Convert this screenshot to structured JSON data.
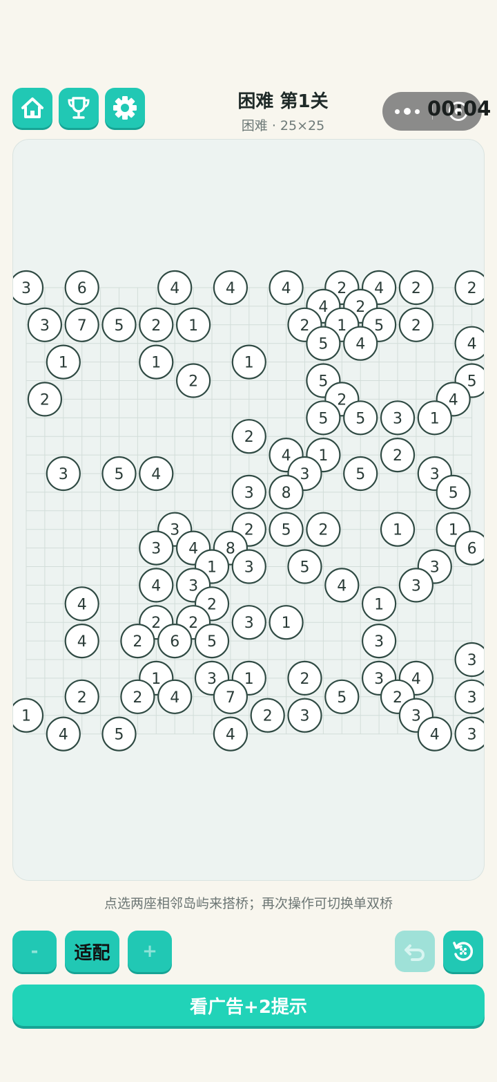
{
  "header": {
    "title": "困难 第1关",
    "subtitle": "困难 · 25×25",
    "timer": "00:04"
  },
  "icons": {
    "home": "home-icon",
    "trophy": "trophy-icon",
    "settings": "gear-icon",
    "undo": "undo-icon",
    "reset": "restart-icon"
  },
  "colors": {
    "accent": "#21c8b4",
    "island_stroke": "#2f4a43",
    "grid": "#d2ddd9"
  },
  "board": {
    "islands": [
      {
        "c": 0,
        "r": 0,
        "n": 3
      },
      {
        "c": 3,
        "r": 0,
        "n": 6
      },
      {
        "c": 8,
        "r": 0,
        "n": 4
      },
      {
        "c": 11,
        "r": 0,
        "n": 4
      },
      {
        "c": 14,
        "r": 0,
        "n": 4
      },
      {
        "c": 17,
        "r": 0,
        "n": 2
      },
      {
        "c": 19,
        "r": 0,
        "n": 4
      },
      {
        "c": 21,
        "r": 0,
        "n": 2
      },
      {
        "c": 24,
        "r": 0,
        "n": 2
      },
      {
        "c": 16,
        "r": 1,
        "n": 4
      },
      {
        "c": 18,
        "r": 1,
        "n": 2
      },
      {
        "c": 1,
        "r": 2,
        "n": 3
      },
      {
        "c": 3,
        "r": 2,
        "n": 7
      },
      {
        "c": 5,
        "r": 2,
        "n": 5
      },
      {
        "c": 7,
        "r": 2,
        "n": 2
      },
      {
        "c": 9,
        "r": 2,
        "n": 1
      },
      {
        "c": 15,
        "r": 2,
        "n": 2
      },
      {
        "c": 17,
        "r": 2,
        "n": 1
      },
      {
        "c": 19,
        "r": 2,
        "n": 5
      },
      {
        "c": 21,
        "r": 2,
        "n": 2
      },
      {
        "c": 16,
        "r": 3,
        "n": 5
      },
      {
        "c": 18,
        "r": 3,
        "n": 4
      },
      {
        "c": 24,
        "r": 3,
        "n": 4
      },
      {
        "c": 2,
        "r": 4,
        "n": 1
      },
      {
        "c": 7,
        "r": 4,
        "n": 1
      },
      {
        "c": 12,
        "r": 4,
        "n": 1
      },
      {
        "c": 9,
        "r": 5,
        "n": 2
      },
      {
        "c": 16,
        "r": 5,
        "n": 5
      },
      {
        "c": 24,
        "r": 5,
        "n": 5
      },
      {
        "c": 1,
        "r": 6,
        "n": 2
      },
      {
        "c": 17,
        "r": 6,
        "n": 2
      },
      {
        "c": 23,
        "r": 6,
        "n": 4
      },
      {
        "c": 16,
        "r": 7,
        "n": 5
      },
      {
        "c": 18,
        "r": 7,
        "n": 5
      },
      {
        "c": 20,
        "r": 7,
        "n": 3
      },
      {
        "c": 22,
        "r": 7,
        "n": 1
      },
      {
        "c": 12,
        "r": 8,
        "n": 2
      },
      {
        "c": 14,
        "r": 9,
        "n": 4
      },
      {
        "c": 16,
        "r": 9,
        "n": 1
      },
      {
        "c": 20,
        "r": 9,
        "n": 2
      },
      {
        "c": 2,
        "r": 10,
        "n": 3
      },
      {
        "c": 5,
        "r": 10,
        "n": 5
      },
      {
        "c": 7,
        "r": 10,
        "n": 4
      },
      {
        "c": 15,
        "r": 10,
        "n": 3
      },
      {
        "c": 18,
        "r": 10,
        "n": 5
      },
      {
        "c": 22,
        "r": 10,
        "n": 3
      },
      {
        "c": 12,
        "r": 11,
        "n": 3
      },
      {
        "c": 14,
        "r": 11,
        "n": 8
      },
      {
        "c": 23,
        "r": 11,
        "n": 5
      },
      {
        "c": 8,
        "r": 13,
        "n": 3
      },
      {
        "c": 12,
        "r": 13,
        "n": 2
      },
      {
        "c": 14,
        "r": 13,
        "n": 5
      },
      {
        "c": 16,
        "r": 13,
        "n": 2
      },
      {
        "c": 20,
        "r": 13,
        "n": 1
      },
      {
        "c": 23,
        "r": 13,
        "n": 1
      },
      {
        "c": 7,
        "r": 14,
        "n": 3
      },
      {
        "c": 9,
        "r": 14,
        "n": 4
      },
      {
        "c": 11,
        "r": 14,
        "n": 8
      },
      {
        "c": 24,
        "r": 14,
        "n": 6
      },
      {
        "c": 10,
        "r": 15,
        "n": 1
      },
      {
        "c": 12,
        "r": 15,
        "n": 3
      },
      {
        "c": 15,
        "r": 15,
        "n": 5
      },
      {
        "c": 22,
        "r": 15,
        "n": 3
      },
      {
        "c": 7,
        "r": 16,
        "n": 4
      },
      {
        "c": 9,
        "r": 16,
        "n": 3
      },
      {
        "c": 17,
        "r": 16,
        "n": 4
      },
      {
        "c": 21,
        "r": 16,
        "n": 3
      },
      {
        "c": 3,
        "r": 17,
        "n": 4
      },
      {
        "c": 10,
        "r": 17,
        "n": 2
      },
      {
        "c": 19,
        "r": 17,
        "n": 1
      },
      {
        "c": 7,
        "r": 18,
        "n": 2
      },
      {
        "c": 9,
        "r": 18,
        "n": 2
      },
      {
        "c": 12,
        "r": 18,
        "n": 3
      },
      {
        "c": 14,
        "r": 18,
        "n": 1
      },
      {
        "c": 3,
        "r": 19,
        "n": 4
      },
      {
        "c": 6,
        "r": 19,
        "n": 2
      },
      {
        "c": 8,
        "r": 19,
        "n": 6
      },
      {
        "c": 10,
        "r": 19,
        "n": 5
      },
      {
        "c": 19,
        "r": 19,
        "n": 3
      },
      {
        "c": 24,
        "r": 20,
        "n": 3
      },
      {
        "c": 7,
        "r": 21,
        "n": 1
      },
      {
        "c": 10,
        "r": 21,
        "n": 3
      },
      {
        "c": 12,
        "r": 21,
        "n": 1
      },
      {
        "c": 15,
        "r": 21,
        "n": 2
      },
      {
        "c": 19,
        "r": 21,
        "n": 3
      },
      {
        "c": 21,
        "r": 21,
        "n": 4
      },
      {
        "c": 3,
        "r": 22,
        "n": 2
      },
      {
        "c": 6,
        "r": 22,
        "n": 2
      },
      {
        "c": 8,
        "r": 22,
        "n": 4
      },
      {
        "c": 11,
        "r": 22,
        "n": 7
      },
      {
        "c": 17,
        "r": 22,
        "n": 5
      },
      {
        "c": 20,
        "r": 22,
        "n": 2
      },
      {
        "c": 24,
        "r": 22,
        "n": 3
      },
      {
        "c": 0,
        "r": 23,
        "n": 1
      },
      {
        "c": 13,
        "r": 23,
        "n": 2
      },
      {
        "c": 15,
        "r": 23,
        "n": 3
      },
      {
        "c": 21,
        "r": 23,
        "n": 3
      },
      {
        "c": 2,
        "r": 24,
        "n": 4
      },
      {
        "c": 5,
        "r": 24,
        "n": 5
      },
      {
        "c": 11,
        "r": 24,
        "n": 4
      },
      {
        "c": 22,
        "r": 24,
        "n": 4
      },
      {
        "c": 24,
        "r": 24,
        "n": 3
      }
    ]
  },
  "hint": "点选两座相邻岛屿来搭桥；再次操作可切换单双桥",
  "controls": {
    "zoom_out": "-",
    "fit": "适配",
    "zoom_in": "+"
  },
  "ad_button": "看广告+2提示"
}
